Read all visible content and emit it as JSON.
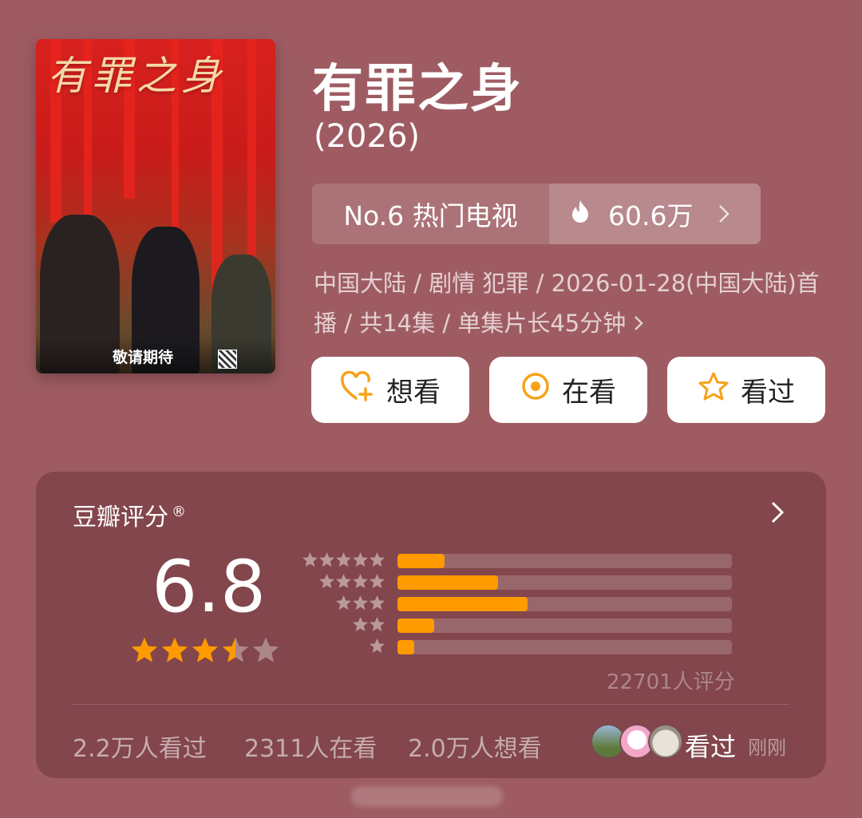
{
  "poster": {
    "title_art": "有罪之身",
    "tagline": "敬请期待"
  },
  "header": {
    "title": "有罪之身",
    "year": "(2026)"
  },
  "rank": {
    "label": "No.6 热门电视",
    "heat": "60.6万",
    "fire_color": "#ffffff"
  },
  "meta": {
    "text": "中国大陆 / 剧情 犯罪 / 2026-01-28(中国大陆)首播 / 共14集 / 单集片长45分钟"
  },
  "actions": [
    {
      "label": "想看",
      "icon": "heart-plus-icon"
    },
    {
      "label": "在看",
      "icon": "target-icon"
    },
    {
      "label": "看过",
      "icon": "star-outline-icon"
    }
  ],
  "accent": "#ff9a00",
  "rating": {
    "label": "豆瓣评分",
    "mark": "®",
    "score": "6.8",
    "stars_value": 3.5,
    "count": "22701人评分",
    "distribution": [
      {
        "stars": 5,
        "fraction": 0.14
      },
      {
        "stars": 4,
        "fraction": 0.3
      },
      {
        "stars": 3,
        "fraction": 0.39
      },
      {
        "stars": 2,
        "fraction": 0.11
      },
      {
        "stars": 1,
        "fraction": 0.05
      }
    ]
  },
  "stats": {
    "seen": "2.2万人看过",
    "watching": "2311人在看",
    "want": "2.0万人想看"
  },
  "friends": {
    "label": "看过",
    "time": "刚刚"
  }
}
